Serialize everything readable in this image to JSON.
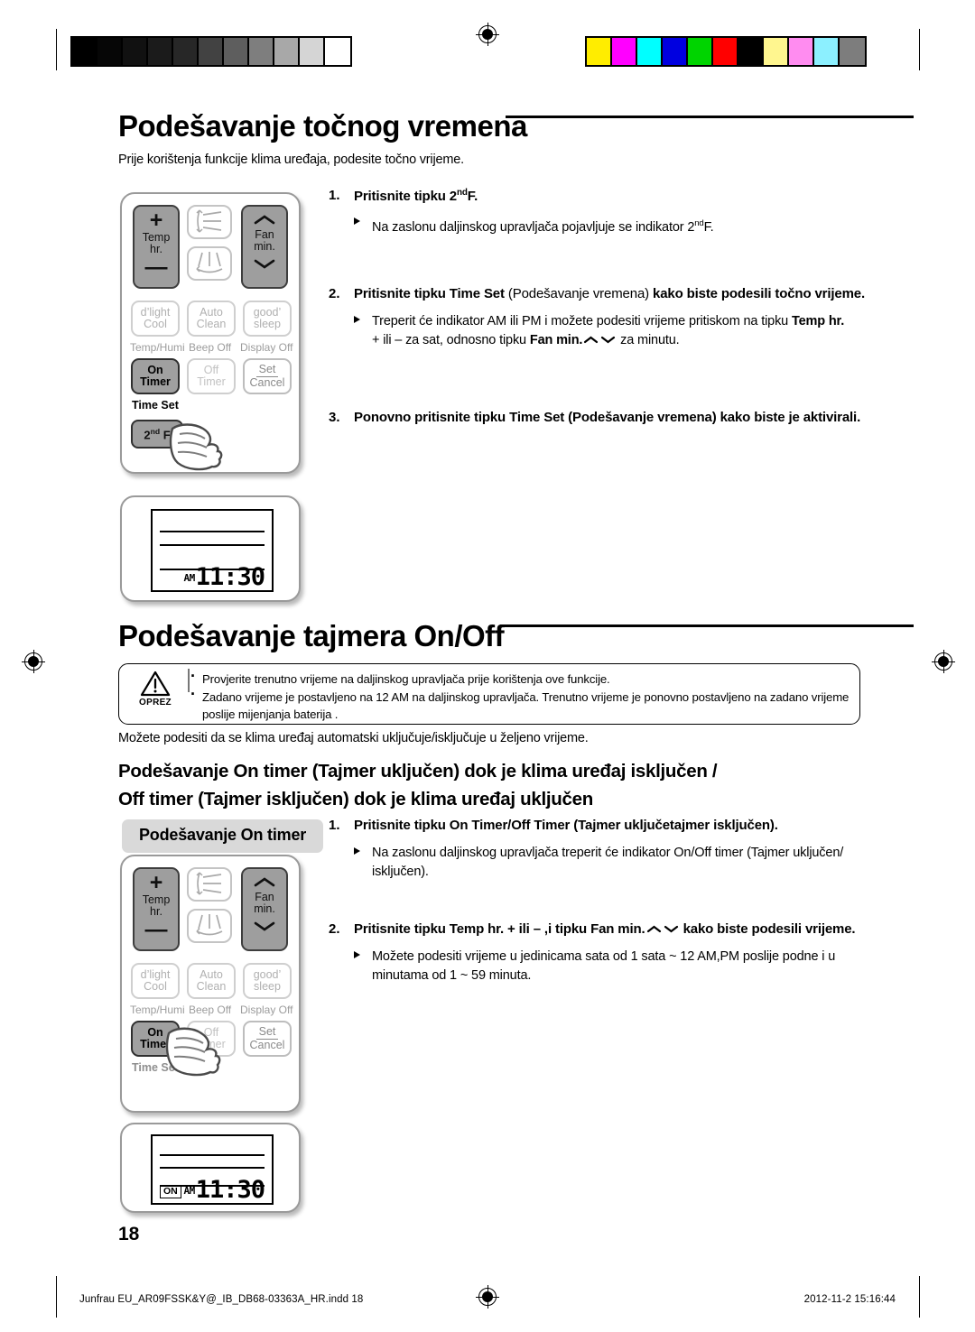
{
  "page": {
    "number": "18",
    "footer_left": "Junfrau EU_AR09FSSK&Y@_IB_DB68-03363A_HR.indd   18",
    "footer_right": "2012-11-2   15:16:44"
  },
  "calibration": {
    "gray_bar": [
      "#000000",
      "#060606",
      "#111111",
      "#1b1b1b",
      "#272727",
      "#424242",
      "#5e5e5e",
      "#7e7e7e",
      "#a8a8a8",
      "#d5d5d5",
      "#ffffff"
    ],
    "color_bar": [
      "#ffed00",
      "#ff00ff",
      "#00ffff",
      "#0000e0",
      "#00d400",
      "#ff0000",
      "#000000",
      "#fff68f",
      "#ff8cf0",
      "#8cf0ff",
      "#7d7d7d"
    ],
    "registration_icon": "registration-target-icon"
  },
  "section_clock": {
    "heading": "Podešavanje točnog vremena",
    "intro": "Prije korištenja funkcije klima uređaja, podesite točno vrijeme.",
    "steps": [
      {
        "num": "1.",
        "text_parts": [
          {
            "t": "Pritisnite tipku ",
            "bold": true
          },
          {
            "t": "2",
            "bold": true
          },
          {
            "t": "nd",
            "bold": true,
            "sup": true
          },
          {
            "t": "F.",
            "bold": true
          }
        ],
        "bullets": [
          [
            {
              "t": "Na zaslonu daljinskog upravljača pojavljuje se indikator 2"
            },
            {
              "t": "nd",
              "sup": true
            },
            {
              "t": "F."
            }
          ]
        ]
      },
      {
        "num": "2.",
        "text_parts": [
          {
            "t": "Pritisnite tipku ",
            "bold": true
          },
          {
            "t": "Time Set",
            "bold": true
          },
          {
            "t": " (Podešavanje vremena) ",
            "bold": false
          },
          {
            "t": "kako biste podesili točno vrijeme.",
            "bold": true
          }
        ],
        "bullets": [
          [
            {
              "t": "Treperit će indikator AM ili PM i možete podesiti vrijeme pritiskom na tipku "
            },
            {
              "t": "Temp hr.",
              "bold": true
            },
            {
              "t": "\n"
            },
            {
              "t": "+ ili – za sat, odnosno tipku "
            },
            {
              "t": "Fan min.",
              "bold": true
            },
            {
              "t": " ",
              "chevrons": true
            },
            {
              "t": " za minutu."
            }
          ]
        ]
      },
      {
        "num": "3.",
        "text_parts": [
          {
            "t": "Ponovno pritisnite tipku ",
            "bold": true
          },
          {
            "t": "Time Set (Podešavanje vremena)",
            "bold": true
          },
          {
            "t": " kako biste je aktivirali.",
            "bold": true
          }
        ],
        "bullets": []
      }
    ],
    "lcd": {
      "am_pm": "AM",
      "time": "11:30"
    }
  },
  "section_timer": {
    "heading": "Podešavanje tajmera On/Off",
    "caution": {
      "icon": "warning-triangle-icon",
      "label": "OPREZ",
      "items": [
        "Provjerite trenutno vrijeme na daljinskog upravljača prije korištenja ove funkcije.",
        "Zadano vrijeme je postavljeno na 12 AM na daljinskog upravljača. Trenutno vrijeme je ponovno postavljeno na zadano vrijeme poslije mijenjanja baterija ."
      ]
    },
    "intro": "Možete podesiti da se klima uređaj automatski uključuje/isključuje u željeno vrijeme.",
    "subheading_line1": "Podešavanje On timer (Tajmer uključen) dok je klima uređaj isključen /",
    "subheading_line2": "Off timer (Tajmer isključen) dok je klima uređaj uključen",
    "pill_label": "Podešavanje On timer",
    "steps": [
      {
        "num": "1.",
        "text_parts": [
          {
            "t": "Pritisnite tipku On Timer/Off Timer (Tajmer uključetajmer isključen).",
            "bold": true
          }
        ],
        "bullets": [
          [
            {
              "t": "Na zaslonu daljinskog upravljača treperit će indikator On/Off timer (Tajmer uključen/"
            },
            {
              "t": "\n"
            },
            {
              "t": "isključen)."
            }
          ]
        ]
      },
      {
        "num": "2.",
        "text_parts": [
          {
            "t": "Pritisnite tipku ",
            "bold": true
          },
          {
            "t": "Temp hr.",
            "bold": true
          },
          {
            "t": " + ili – ,i tipku ",
            "bold": true
          },
          {
            "t": "Fan min.",
            "bold": true
          },
          {
            "t": " ",
            "chevrons": true
          },
          {
            "t": " kako biste podesili vrijeme.",
            "bold": true
          }
        ],
        "bullets": [
          [
            {
              "t": "Možete podesiti vrijeme u jedinicama sata od 1 sata ~ 12 AM,PM poslije podne i u"
            },
            {
              "t": "\n"
            },
            {
              "t": "minutama od 1 ~ 59 minuta."
            }
          ]
        ]
      }
    ],
    "lcd": {
      "on_badge": "ON",
      "am_pm": "AM",
      "time": "11:30"
    }
  },
  "remote": {
    "temp_button": {
      "plus": "+",
      "line1": "Temp",
      "line2": "hr.",
      "minus": "—"
    },
    "fan_button": {
      "up": "up-chevron-icon",
      "line1": "Fan",
      "line2": "min.",
      "down": "down-chevron-icon"
    },
    "swing_vertical": "vertical-airflow-icon",
    "swing_horizontal": "horizontal-airflow-icon",
    "function_buttons": [
      {
        "line1": "d’light",
        "line2": "Cool",
        "caption": "Temp/Humi"
      },
      {
        "line1": "Auto",
        "line2": "Clean",
        "caption": "Beep Off"
      },
      {
        "line1": "good’",
        "line2": "sleep",
        "caption": "Display Off"
      }
    ],
    "on_timer": {
      "line1": "On",
      "line2": "Timer"
    },
    "off_timer": {
      "line1": "Off",
      "line2": "Timer"
    },
    "set_cancel": {
      "line1": "Set",
      "line2": "Cancel"
    },
    "time_set_caption": "Time Set",
    "second_function": {
      "label": "2",
      "sup": "nd",
      "label2": " F"
    },
    "hand_icon": "pointing-hand-icon"
  }
}
